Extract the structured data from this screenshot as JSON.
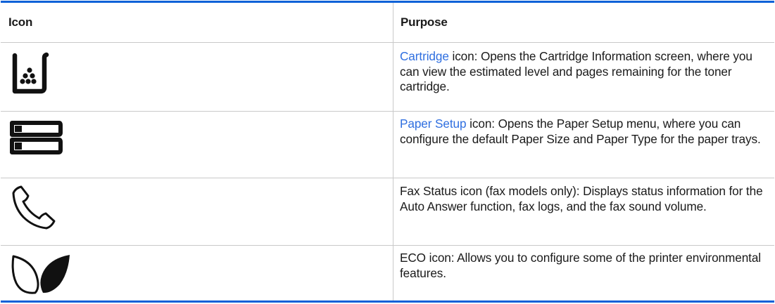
{
  "table": {
    "headers": {
      "icon": "Icon",
      "purpose": "Purpose"
    },
    "accent_color": "#0c61d8",
    "link_color": "#2f6fe0",
    "rows": [
      {
        "icon": "cartridge-icon",
        "link": "Cartridge",
        "text": " icon: Opens the Cartridge Information screen, where you can view the estimated level and pages remaining for the toner cartridge."
      },
      {
        "icon": "paper-setup-icon",
        "link": "Paper Setup",
        "text": " icon: Opens the Paper Setup menu, where you can configure the default Paper Size and Paper Type for the paper trays."
      },
      {
        "icon": "fax-status-icon",
        "link": "",
        "text": "Fax Status icon (fax models only): Displays status information for the Auto Answer function, fax logs, and the fax sound volume."
      },
      {
        "icon": "eco-icon",
        "link": "",
        "text": "ECO icon: Allows you to configure some of the printer environmental features."
      }
    ]
  }
}
